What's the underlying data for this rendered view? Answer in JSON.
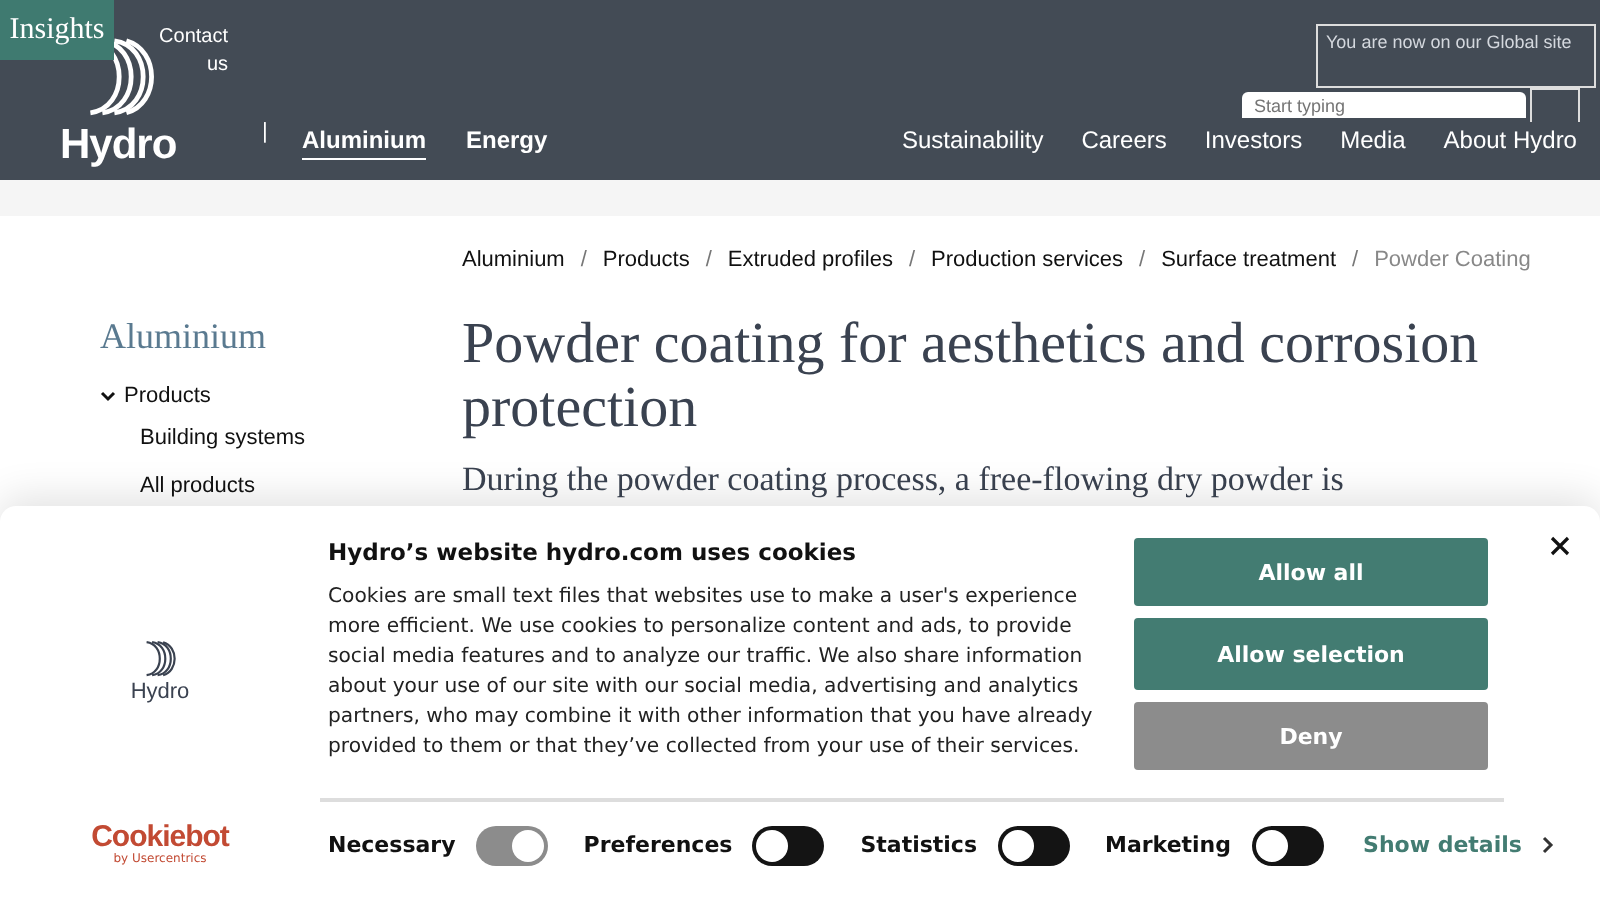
{
  "header": {
    "badge": "Insights",
    "contact": "Contact us",
    "logo_text": "Hydro",
    "divider": "|",
    "main_nav": [
      {
        "label": "Aluminium",
        "selected": true
      },
      {
        "label": "Energy",
        "selected": false
      }
    ],
    "nav": [
      "Sustainability",
      "Careers",
      "Investors",
      "Media",
      "About Hydro"
    ],
    "site_notice": "You are now on our Global site",
    "search": {
      "placeholder": "Start typing"
    }
  },
  "breadcrumb_separator": "/",
  "breadcrumb": [
    {
      "label": "Aluminium",
      "current": false
    },
    {
      "label": "Products",
      "current": false
    },
    {
      "label": "Extruded profiles",
      "current": false
    },
    {
      "label": "Production services",
      "current": false
    },
    {
      "label": "Surface treatment",
      "current": false
    },
    {
      "label": "Powder Coating",
      "current": true
    }
  ],
  "sidebar": {
    "title": "Aluminium",
    "items": [
      {
        "label": "Products",
        "expanded": true,
        "children": [
          {
            "label": "Building systems"
          },
          {
            "label": "All products"
          }
        ]
      }
    ]
  },
  "article": {
    "title": "Powder coating for aesthetics and corrosion protection",
    "lead": "During the powder coating process, a free-flowing dry powder is"
  },
  "cookie_banner": {
    "logo_text": "Hydro",
    "title": "Hydro’s website hydro.com uses cookies",
    "body": "Cookies are small text files that websites use to make a user's experience more efficient. We use cookies to personalize content and ads, to provide social media features and to analyze our traffic. We also share information about your use of our site with our social media, advertising and analytics partners, who may combine it with other information that you have already provided to them or that they’ve collected from your use of their services.",
    "buttons": [
      {
        "label": "Allow all",
        "kind": "primary"
      },
      {
        "label": "Allow selection",
        "kind": "primary"
      },
      {
        "label": "Deny",
        "kind": "secondary"
      }
    ],
    "toggles": [
      {
        "label": "Necessary",
        "on": true,
        "disabled": true
      },
      {
        "label": "Preferences",
        "on": false,
        "disabled": false
      },
      {
        "label": "Statistics",
        "on": false,
        "disabled": false
      },
      {
        "label": "Marketing",
        "on": false,
        "disabled": false
      }
    ],
    "details_link": "Show details",
    "brand": "Cookiebot",
    "brand_sub": "by Usercentrics"
  }
}
